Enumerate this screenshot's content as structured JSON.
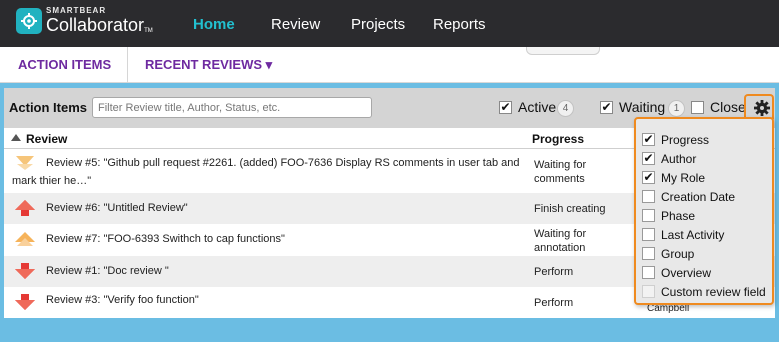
{
  "topbar": {
    "brand_small": "SMARTBEAR",
    "brand_name": "Collaborator",
    "brand_tm": "TM",
    "nav": [
      "Home",
      "Review",
      "Projects",
      "Reports"
    ]
  },
  "tabs": {
    "action_items": "ACTION ITEMS",
    "recent_reviews": "RECENT REVIEWS ▾"
  },
  "widget": {
    "title": "Action Items",
    "filter_placeholder": "Filter Review title, Author, Status, etc.",
    "active_label": "Active",
    "active_count": "4",
    "waiting_label": "Waiting",
    "waiting_count": "1",
    "closed_label": "Closed"
  },
  "table": {
    "col_review": "Review",
    "col_progress": "Progress",
    "rows": [
      {
        "priority": "medium",
        "title": "Review #5: \"Github pull request #2261. (added) FOO-7636 Display RS comments in user tab and",
        "title2": "mark thier he…\"",
        "progress": "Waiting for",
        "progress2": "comments"
      },
      {
        "priority": "high",
        "title": "Review #6: \"Untitled Review\"",
        "progress": "Finish creating"
      },
      {
        "priority": "medium",
        "title": "Review #7: \"FOO-6393 Swithch to cap functions\"",
        "progress": "Waiting for",
        "progress2": "annotation"
      },
      {
        "priority": "low",
        "title": "Review #1: \"Doc review \"",
        "progress": "Perform"
      },
      {
        "priority": "low",
        "title": "Review #3: \"Verify foo function\"",
        "progress": "Perform",
        "extra": "Campbell"
      }
    ]
  },
  "columns_popup": {
    "options": [
      {
        "label": "Progress",
        "checked": true
      },
      {
        "label": "Author",
        "checked": true
      },
      {
        "label": "My Role",
        "checked": true
      },
      {
        "label": "Creation Date",
        "checked": false
      },
      {
        "label": "Phase",
        "checked": false
      },
      {
        "label": "Last Activity",
        "checked": false
      },
      {
        "label": "Group",
        "checked": false
      },
      {
        "label": "Overview",
        "checked": false
      },
      {
        "label": "Custom review field",
        "checked": false,
        "disabled": true
      }
    ]
  },
  "colors": {
    "topbar": "#2b2b2e",
    "home_accent": "#22c0d0",
    "tab_text": "#6e2aa0",
    "panel_blue": "#6bbde3",
    "popup_border": "#ef8a1f",
    "arrow_high": "#e53935",
    "arrow_medium": "#f6b35a",
    "arrow_low": "#e53935"
  }
}
